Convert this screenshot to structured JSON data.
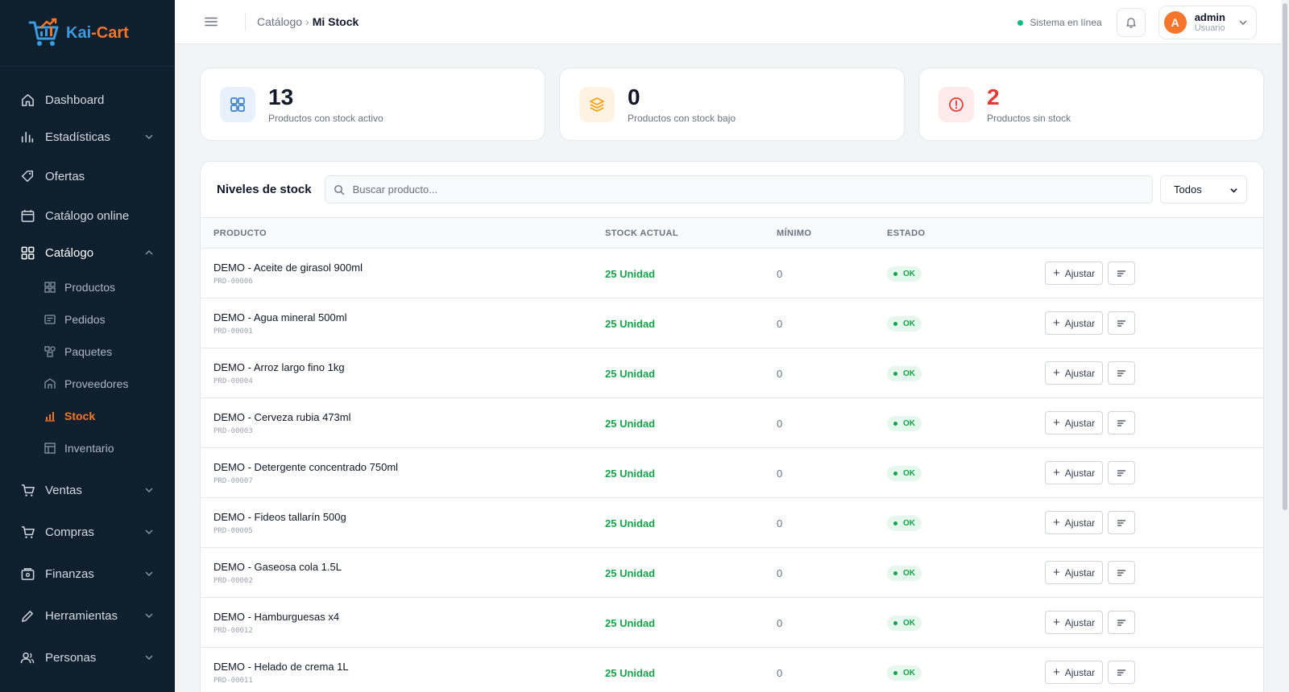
{
  "brand": {
    "name_part1": "Kai",
    "name_part2": "-Cart"
  },
  "sidebar": {
    "items": [
      {
        "label": "Dashboard",
        "icon": "home-icon"
      },
      {
        "label": "Estadísticas",
        "icon": "bar-chart-icon"
      },
      {
        "label": "Ofertas",
        "icon": "tag-icon"
      },
      {
        "label": "Catálogo online",
        "icon": "calendar-icon"
      },
      {
        "label": "Catálogo",
        "icon": "grid-icon"
      },
      {
        "label": "Ventas",
        "icon": "cart-icon"
      },
      {
        "label": "Compras",
        "icon": "cart-icon"
      },
      {
        "label": "Finanzas",
        "icon": "wallet-icon"
      },
      {
        "label": "Herramientas",
        "icon": "pencil-icon"
      },
      {
        "label": "Personas",
        "icon": "users-icon"
      }
    ],
    "sub_items": [
      {
        "label": "Productos",
        "icon": "grid-icon"
      },
      {
        "label": "Pedidos",
        "icon": "receipt-icon"
      },
      {
        "label": "Paquetes",
        "icon": "package-icon"
      },
      {
        "label": "Proveedores",
        "icon": "store-icon"
      },
      {
        "label": "Stock",
        "icon": "bar-chart-icon"
      },
      {
        "label": "Inventario",
        "icon": "table-icon"
      }
    ]
  },
  "topbar": {
    "breadcrumb_parent": "Catálogo",
    "breadcrumb_sep": "›",
    "breadcrumb_current": "Mi Stock",
    "system_status": "Sistema en línea",
    "user": {
      "initial": "A",
      "name": "admin",
      "role": "Usuario"
    }
  },
  "stats": [
    {
      "value": "13",
      "label": "Productos con stock activo",
      "color": "#3b82c4"
    },
    {
      "value": "0",
      "label": "Productos con stock bajo",
      "color": "#f59e0b"
    },
    {
      "value": "2",
      "label": "Productos sin stock",
      "color": "#e53935"
    }
  ],
  "stock_panel": {
    "title": "Niveles de stock",
    "search_placeholder": "Buscar producto...",
    "filter_value": "Todos",
    "columns": {
      "product": "PRODUCTO",
      "stock": "STOCK ACTUAL",
      "min": "MÍNIMO",
      "state": "ESTADO"
    },
    "adjust_label": "Ajustar",
    "rows": [
      {
        "name": "DEMO - Aceite de girasol 900ml",
        "code": "PRD-00006",
        "stock": "25 Unidad",
        "min": "0",
        "state": "OK"
      },
      {
        "name": "DEMO - Agua mineral 500ml",
        "code": "PRD-00001",
        "stock": "25 Unidad",
        "min": "0",
        "state": "OK"
      },
      {
        "name": "DEMO - Arroz largo fino 1kg",
        "code": "PRD-00004",
        "stock": "25 Unidad",
        "min": "0",
        "state": "OK"
      },
      {
        "name": "DEMO - Cerveza rubia 473ml",
        "code": "PRD-00003",
        "stock": "25 Unidad",
        "min": "0",
        "state": "OK"
      },
      {
        "name": "DEMO - Detergente concentrado 750ml",
        "code": "PRD-00007",
        "stock": "25 Unidad",
        "min": "0",
        "state": "OK"
      },
      {
        "name": "DEMO - Fideos tallarín 500g",
        "code": "PRD-00005",
        "stock": "25 Unidad",
        "min": "0",
        "state": "OK"
      },
      {
        "name": "DEMO - Gaseosa cola 1.5L",
        "code": "PRD-00002",
        "stock": "25 Unidad",
        "min": "0",
        "state": "OK"
      },
      {
        "name": "DEMO - Hamburguesas x4",
        "code": "PRD-00012",
        "stock": "25 Unidad",
        "min": "0",
        "state": "OK"
      },
      {
        "name": "DEMO - Helado de crema 1L",
        "code": "PRD-00011",
        "stock": "25 Unidad",
        "min": "0",
        "state": "OK"
      }
    ]
  },
  "colors": {
    "sidebar_bg": "#0f1f2e",
    "accent": "#f5762a",
    "ok_green": "#16a34a"
  }
}
